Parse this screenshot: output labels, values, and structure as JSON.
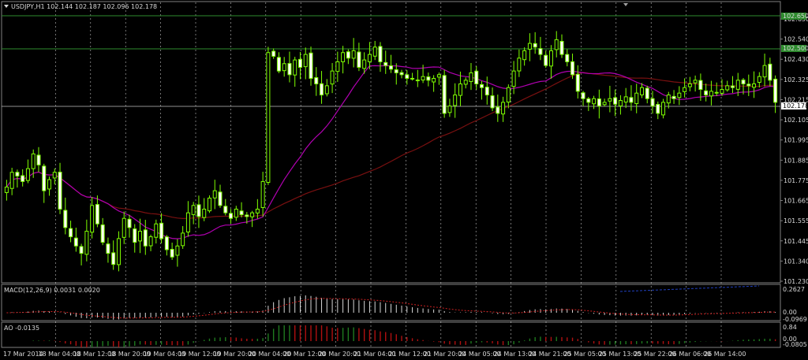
{
  "window": {
    "symbol_header": "USDJPY,H1 102.144 102.187 102.096 102.178"
  },
  "price_axis": {
    "labels": [
      "102.650",
      "102.540",
      "102.430",
      "102.325",
      "102.215",
      "102.105",
      "101.995",
      "101.885",
      "101.775",
      "101.665",
      "101.555",
      "101.445",
      "101.340",
      "101.230"
    ],
    "current_price_label": "102.178",
    "level_label_top": "102.650",
    "level_label_mid": "102.500"
  },
  "time_axis": {
    "labels": [
      "17 Mar 2014",
      "18 Mar 04:00",
      "18 Mar 12:00",
      "18 Mar 20:00",
      "19 Mar 04:00",
      "19 Mar 12:00",
      "19 Mar 20:00",
      "20 Mar 04:00",
      "20 Mar 12:00",
      "20 Mar 20:00",
      "21 Mar 04:00",
      "21 Mar 12:00",
      "21 Mar 20:00",
      "24 Mar 05:00",
      "24 Mar 13:00",
      "24 Mar 21:00",
      "25 Mar 05:00",
      "25 Mar 13:00",
      "25 Mar 22:00",
      "26 Mar 06:00",
      "26 Mar 14:00"
    ]
  },
  "macd_panel": {
    "title": "MACD(12,26,9) 0.0031 0.0020",
    "axis_labels": [
      "0.2627",
      "0.00",
      "-0.0969"
    ]
  },
  "ao_panel": {
    "title": "AO -0.0135",
    "axis_labels": [
      "0.84",
      "0.00",
      "-0.0805"
    ]
  },
  "colors": {
    "background": "#000000",
    "candle_up": "#ffffff",
    "candle_down": "#7fff00",
    "ma_fast": "#b000b0",
    "ma_slow": "#7a1010",
    "grid": "#ffffff",
    "level_line": "#2e8b2e",
    "macd_hist": "#d8d8d8",
    "macd_signal": "#cc2020",
    "ao_up": "#1f7a1f",
    "ao_down": "#b01010",
    "trend_line": "#2040c0"
  },
  "chart_data": {
    "type": "candlestick",
    "instrument": "USDJPY",
    "timeframe": "H1",
    "ylim": [
      101.23,
      102.65
    ],
    "closes": [
      101.72,
      101.8,
      101.78,
      101.75,
      101.82,
      101.9,
      101.84,
      101.7,
      101.76,
      101.8,
      101.6,
      101.5,
      101.45,
      101.4,
      101.36,
      101.48,
      101.62,
      101.52,
      101.42,
      101.36,
      101.3,
      101.44,
      101.55,
      101.5,
      101.42,
      101.48,
      101.4,
      101.45,
      101.52,
      101.44,
      101.38,
      101.34,
      101.4,
      101.47,
      101.58,
      101.62,
      101.56,
      101.6,
      101.66,
      101.7,
      101.62,
      101.58,
      101.55,
      101.6,
      101.57,
      101.56,
      101.58,
      101.6,
      101.75,
      102.45,
      102.43,
      102.35,
      102.39,
      102.33,
      102.41,
      102.37,
      102.44,
      102.31,
      102.28,
      102.22,
      102.27,
      102.35,
      102.4,
      102.45,
      102.42,
      102.46,
      102.37,
      102.41,
      102.44,
      102.48,
      102.4,
      102.38,
      102.36,
      102.34,
      102.33,
      102.31,
      102.31,
      102.3,
      102.32,
      102.3,
      102.31,
      102.33,
      102.12,
      102.16,
      102.22,
      102.28,
      102.3,
      102.34,
      102.28,
      102.26,
      102.22,
      102.15,
      102.12,
      102.18,
      102.26,
      102.35,
      102.42,
      102.46,
      102.5,
      102.48,
      102.44,
      102.38,
      102.46,
      102.52,
      102.44,
      102.4,
      102.33,
      102.24,
      102.2,
      102.18,
      102.2,
      102.16,
      102.18,
      102.2,
      102.17,
      102.19,
      102.21,
      102.18,
      102.23,
      102.26,
      102.2,
      102.16,
      102.12,
      102.18,
      102.22,
      102.2,
      102.23,
      102.26,
      102.28,
      102.3,
      102.25,
      102.22,
      102.24,
      102.23,
      102.25,
      102.27,
      102.26,
      102.3,
      102.28,
      102.27,
      102.28,
      102.32,
      102.38,
      102.3,
      102.18
    ]
  }
}
